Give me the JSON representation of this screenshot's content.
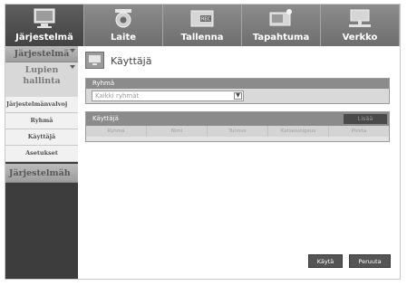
{
  "nav": {
    "tabs": [
      {
        "label": "Järjestelmä",
        "icon": "monitor-icon"
      },
      {
        "label": "Laite",
        "icon": "camera-icon"
      },
      {
        "label": "Tallenna",
        "icon": "rec-icon"
      },
      {
        "label": "Tapahtuma",
        "icon": "event-icon"
      },
      {
        "label": "Verkko",
        "icon": "network-icon"
      }
    ]
  },
  "sidebar": {
    "section1": "Järjestelmä",
    "selected": "Lupien hallinta",
    "items": [
      "Järjestelmänvalvoj",
      "Ryhmä",
      "Käyttäjä",
      "Asetukset"
    ],
    "section2": "Järjestelmäh"
  },
  "page": {
    "title": "Käyttäjä",
    "group_header": "Ryhmä",
    "group_select_value": "Kaikki ryhmät",
    "user_header": "Käyttäjä",
    "add_button": "Lisää",
    "columns": [
      "Ryhmä",
      "Nimi",
      "Tunnus",
      "Katseluoigeus",
      "Poista"
    ]
  },
  "buttons": {
    "apply": "Käytä",
    "cancel": "Peruuta"
  },
  "colors": {
    "active_tab": "#4f4f4f",
    "header_bar": "#8b8b8b"
  }
}
